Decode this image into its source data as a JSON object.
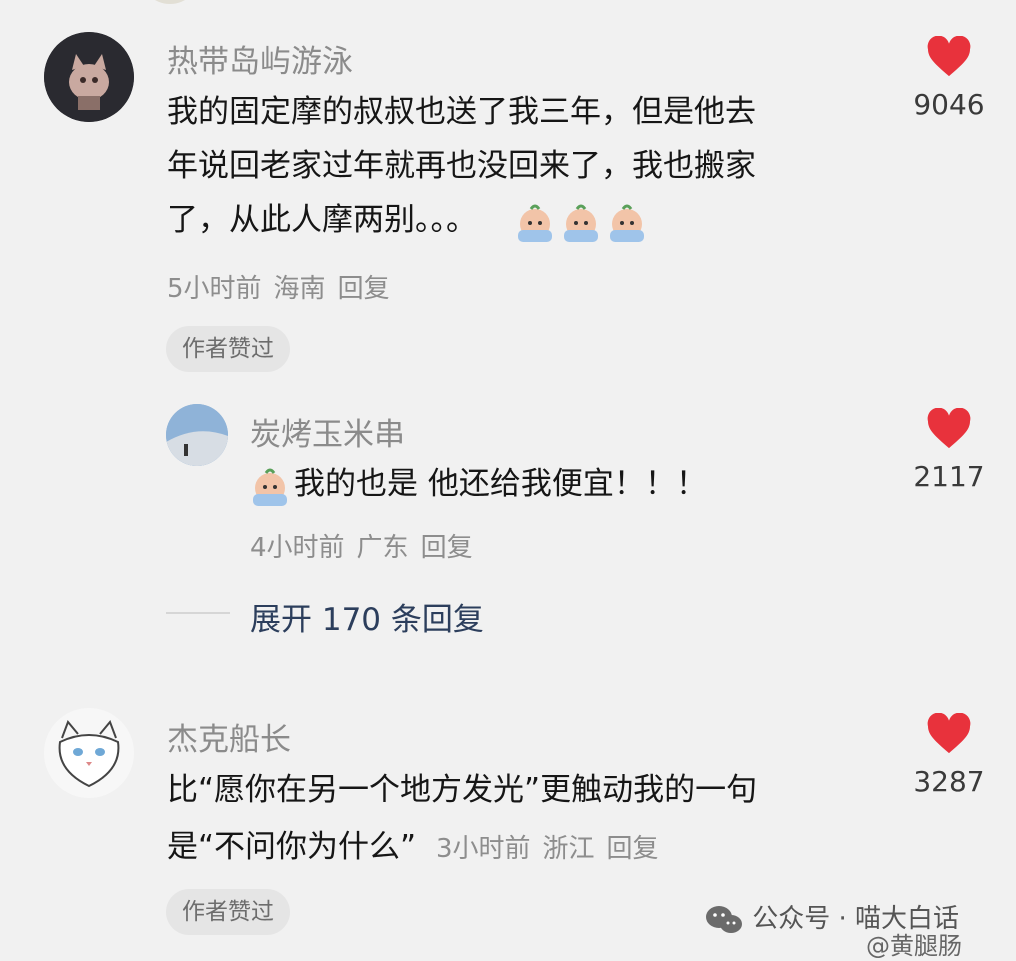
{
  "comments": [
    {
      "username": "热带岛屿游泳",
      "lines": [
        "我的固定摩的叔叔也送了我三年，但是他去",
        "年说回老家过年就再也没回来了，我也搬家",
        "了，从此人摩两别。。。"
      ],
      "meta": {
        "time": "5小时前",
        "location": "海南",
        "reply": "回复"
      },
      "likes": "9046",
      "badge": "作者赞过"
    },
    {
      "username": "炭烤玉米串",
      "lines": [
        "我的也是 他还给我便宜！！！"
      ],
      "meta": {
        "time": "4小时前",
        "location": "广东",
        "reply": "回复"
      },
      "likes": "2117"
    },
    {
      "username": "杰克船长",
      "lines": [
        "比“愿你在另一个地方发光”更触动我的一句",
        "是“不问你为什么”"
      ],
      "meta": {
        "time": "3小时前",
        "location": "浙江",
        "reply": "回复"
      },
      "likes": "3287",
      "badge": "作者赞过"
    }
  ],
  "expand_replies": "展开 170 条回复",
  "watermarks": {
    "wechat": "公众号 · 喵大白话",
    "weibo": "@黄腿肠"
  },
  "colors": {
    "heart": "#e8323c",
    "background": "#f1f1f1",
    "expand": "#2c3e5c"
  }
}
